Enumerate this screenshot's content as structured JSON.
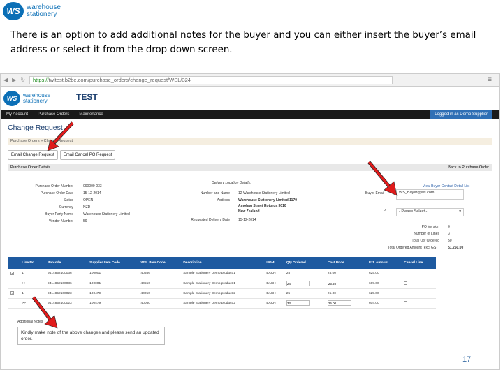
{
  "slide": {
    "logo_badge": "WS",
    "logo_line1": "warehouse",
    "logo_line2": "stationery",
    "caption": "There is an option to add additional notes for the buyer and you can either insert the buyer’s email address or select it from the drop down screen.",
    "slide_number": "17"
  },
  "browser": {
    "url_https": "https://",
    "url_rest": "twltest.b2be.com/purchase_orders/change_request/WSL/324"
  },
  "app": {
    "title": "TEST",
    "nav": [
      "My Account",
      "Purchase Orders",
      "Maintenance"
    ],
    "login": "Logged in as Demo Supplier",
    "page_title": "Change Request",
    "page_subtitle": "Change Request",
    "crumb": "Purchase Orders  »  Change Request",
    "btn_email": "Email Change Request",
    "btn_cancel": "Email Cancel PO Request",
    "panel_title": "Purchase Order Details",
    "back_link": "Back to Purchase Order"
  },
  "details": {
    "left": [
      {
        "label": "Purchase Order Number",
        "value": "090009-033"
      },
      {
        "label": "Purchase Order Date",
        "value": "15-12-2014"
      },
      {
        "label": "Status",
        "value": "OPEN"
      },
      {
        "label": "Currency",
        "value": "NZD"
      },
      {
        "label": "Buyer Party Name",
        "value": "Warehouse Stationery Limited"
      },
      {
        "label": "Vendor Number",
        "value": "59"
      }
    ],
    "delivery_title": "Delivery Location Details:",
    "delivery": [
      {
        "label": "Number and Name",
        "value": "12 Warehouse Stationery Limited"
      },
      {
        "label": "Address",
        "value": "Warehouse Stationery Limited 1170"
      },
      {
        "label": "",
        "value": "Amohau Street Rotorua 3010"
      },
      {
        "label": "",
        "value": "New Zealand"
      },
      {
        "label": "Requested Delivery Date",
        "value": "15-12-2014"
      }
    ],
    "buyer_email_label": "Buyer Email",
    "buyer_email_value": "WS_Buyer@ws.com",
    "view_link": "View Buyer Contact Detail List",
    "or": "or",
    "select_placeholder": "- Please Select -",
    "totals": [
      {
        "label": "PO Version",
        "value": "0"
      },
      {
        "label": "Number of Lines",
        "value": "3"
      },
      {
        "label": "Total Qty Ordered",
        "value": "50"
      },
      {
        "label": "Total Ordered Amount (excl GST)",
        "value": "$1,250.00"
      }
    ]
  },
  "table": {
    "headers": [
      "",
      "Line No.",
      "Barcode",
      "Supplier Item Code",
      "WSL Item Code",
      "Description",
      "UOM",
      "Qty Ordered",
      "Cost Price",
      "Ext. Amount",
      "Cancel Line"
    ],
    "rows": [
      {
        "check": true,
        "cells": [
          "1",
          "9414852100036",
          "100001",
          "40556",
          "Sample Stationery Demo product 1",
          "EACH",
          "25",
          "25.00",
          "625.00"
        ],
        "qty_input": false
      },
      {
        "check": false,
        "cells": [
          ">>",
          "9414852100036",
          "100001",
          "40556",
          "Sample Stationery Demo product 1",
          "EACH",
          "24",
          "25.40",
          "609.60"
        ],
        "qty_input": true
      },
      {
        "check": true,
        "cells": [
          "1",
          "9414852100023",
          "100479",
          "40050",
          "Sample Stationery Demo product 2",
          "EACH",
          "25",
          "25.00",
          "625.00"
        ],
        "qty_input": false
      },
      {
        "check": false,
        "cells": [
          ">>",
          "9414852100023",
          "100479",
          "40050",
          "Sample Stationery Demo product 2",
          "EACH",
          "33",
          "25.00",
          "604.00"
        ],
        "qty_input": true
      }
    ]
  },
  "notes": {
    "label": "Additional Notes",
    "text": "Kindly make note of the above changes and please send an updated order."
  },
  "colors": {
    "accent": "#1e5aa0",
    "arrow": "#e01b1b",
    "navbar": "#1a1a1a"
  }
}
